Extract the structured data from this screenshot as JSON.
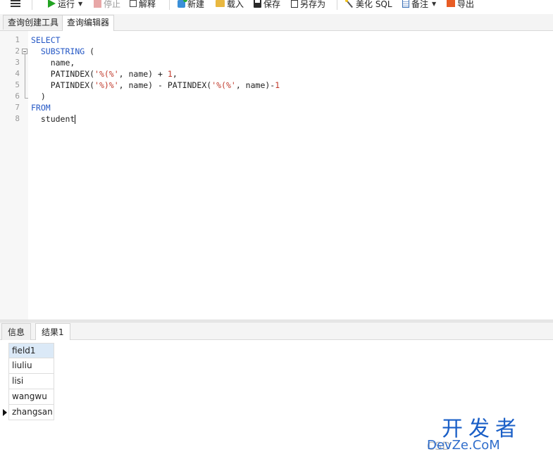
{
  "toolbar": {
    "run": "运行",
    "stop": "停止",
    "explain": "解释",
    "new": "新建",
    "load": "载入",
    "save": "保存",
    "save_as": "另存为",
    "beautify": "美化 SQL",
    "memo": "备注",
    "export": "导出"
  },
  "tabs": {
    "query_builder": "查询创建工具",
    "query_editor": "查询编辑器"
  },
  "editor": {
    "line_numbers": [
      "1",
      "2",
      "3",
      "4",
      "5",
      "6",
      "7",
      "8"
    ],
    "lines": {
      "l1": "SELECT",
      "l2_kw": "SUBSTRING",
      "l2_rest": " (",
      "l3": "name,",
      "l4_a": "PATINDEX(",
      "l4_s": "'%(%'",
      "l4_b": ", name) + ",
      "l4_n": "1",
      "l4_c": ",",
      "l5_a": "PATINDEX(",
      "l5_s1": "'%)%'",
      "l5_b": ", name) - PATINDEX(",
      "l5_s2": "'%(%'",
      "l5_c": ", name)-",
      "l5_n": "1",
      "l6": ")",
      "l7": "FROM",
      "l8": "student"
    }
  },
  "result_tabs": {
    "info": "信息",
    "result1": "结果1"
  },
  "grid": {
    "header": "field1",
    "rows": [
      "liuliu",
      "lisi",
      "wangwu",
      "zhangsan"
    ]
  },
  "watermark": {
    "big": "开发者",
    "small": "DevZe.CoM",
    "csdn": "CSD"
  }
}
